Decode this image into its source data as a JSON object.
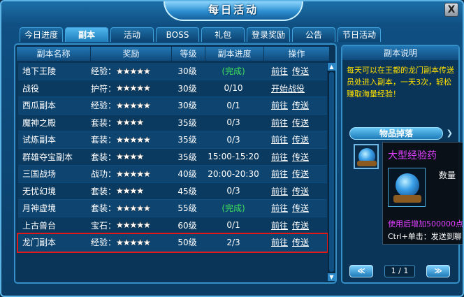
{
  "window": {
    "title": "每日活动",
    "close_label": "X"
  },
  "tabs": [
    {
      "label": "今日进度"
    },
    {
      "label": "副本",
      "active": true
    },
    {
      "label": "活动"
    },
    {
      "label": "BOSS"
    },
    {
      "label": "礼包"
    },
    {
      "label": "登录奖励"
    },
    {
      "label": "公告"
    },
    {
      "label": "节日活动"
    }
  ],
  "table": {
    "headers": [
      "副本名称",
      "奖励",
      "等级",
      "副本进度",
      "操作"
    ],
    "rows": [
      {
        "name": "地下王陵",
        "reward": "经验：",
        "stars": "★★★★★",
        "level": "30级",
        "progress": "(完成)",
        "done": true,
        "op1": "前往",
        "op2": "传送"
      },
      {
        "name": "战役",
        "reward": "护符：",
        "stars": "★★★★★",
        "level": "30级",
        "progress": "0/10",
        "done": false,
        "op1": "开始战役",
        "op2": ""
      },
      {
        "name": "西瓜副本",
        "reward": "经验：",
        "stars": "★★★★★",
        "level": "30级",
        "progress": "0/1",
        "done": false,
        "op1": "前往",
        "op2": "传送"
      },
      {
        "name": "魔神之殿",
        "reward": "套装：",
        "stars": "★★★★",
        "level": "35级",
        "progress": "0/3",
        "done": false,
        "op1": "前往",
        "op2": "传送"
      },
      {
        "name": "试炼副本",
        "reward": "套装：",
        "stars": "★★★★★",
        "level": "35级",
        "progress": "0/3",
        "done": false,
        "op1": "前往",
        "op2": "传送"
      },
      {
        "name": "群雄夺宝副本",
        "reward": "套装：",
        "stars": "★★★★",
        "level": "35级",
        "progress": "15:00-15:20",
        "done": false,
        "op1": "前往",
        "op2": "传送"
      },
      {
        "name": "三国战场",
        "reward": "战功：",
        "stars": "★★★★★",
        "level": "40级",
        "progress": "20:00-20:30",
        "done": false,
        "op1": "前往",
        "op2": "传送"
      },
      {
        "name": "无忧幻境",
        "reward": "套装：",
        "stars": "★★★★",
        "level": "45级",
        "progress": "0/3",
        "done": false,
        "op1": "前往",
        "op2": "传送"
      },
      {
        "name": "月神虚境",
        "reward": "套装：",
        "stars": "★★★★★",
        "level": "55级",
        "progress": "(完成)",
        "done": true,
        "op1": "前往",
        "op2": "传送"
      },
      {
        "name": "上古兽台",
        "reward": "宝石：",
        "stars": "★★★★★",
        "level": "60级",
        "progress": "0/1",
        "done": false,
        "op1": "前往",
        "op2": "传送"
      },
      {
        "name": "龙门副本",
        "reward": "经验：",
        "stars": "★★★★★",
        "level": "50级",
        "progress": "2/3",
        "done": false,
        "op1": "前往",
        "op2": "传送",
        "selected": true
      }
    ]
  },
  "side": {
    "title": "副本说明",
    "description": "每天可以在王都的龙门副本传送员处进入副本，一天3次，轻松赚取海量经验！",
    "drop_title": "物品掉落",
    "page": "1 / 1",
    "prev": "≪",
    "next": "≫"
  },
  "tooltip": {
    "name": "大型经验药",
    "qty_label": "数量",
    "use_text": "使用后增加500000点",
    "ctrl_text": "Ctrl+单击：发送到聊"
  },
  "colors": {
    "accent": "#3690c8",
    "link": "#3fe05a",
    "stars": "#ffb400",
    "highlight": "#e01818",
    "purple": "#e040ff",
    "yellow": "#ffe000"
  }
}
